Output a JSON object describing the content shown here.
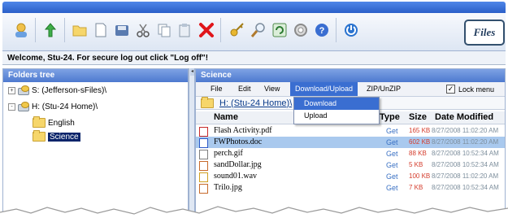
{
  "welcome_message": "Welcome, Stu-24. For secure log out click \"Log off\"!",
  "logo_text": "Files",
  "toolbar_icons": [
    "user-icon",
    "upload-icon",
    "folder-icon",
    "new-file-icon",
    "disk-icon",
    "cut-icon",
    "copy-icon",
    "paste-icon",
    "delete-icon",
    "key-icon",
    "search-icon",
    "refresh-icon",
    "settings-icon",
    "help-icon",
    "power-icon"
  ],
  "folders_panel": {
    "title": "Folders tree",
    "items": [
      {
        "label": "S: (Jefferson-sFiles)\\",
        "expander": "+"
      },
      {
        "label": "H: (Stu-24 Home)\\",
        "expander": "-"
      },
      {
        "label": "English"
      },
      {
        "label": "Science"
      }
    ]
  },
  "files_panel": {
    "title": "Science",
    "menu": [
      "File",
      "Edit",
      "View",
      "Download/Upload",
      "ZIP/UnZIP"
    ],
    "lock_menu": {
      "label": "Lock menu",
      "checked": true,
      "check_mark": "✓"
    },
    "path": "H: (Stu-24 Home)\\",
    "dropdown": [
      "Download",
      "Upload"
    ],
    "columns": [
      "Name",
      "Type",
      "Size",
      "Date Modified"
    ],
    "sort_indicator": "▲",
    "files": [
      {
        "name": "Flash Activity.pdf",
        "type": "Get",
        "size": "165 KB",
        "date": "8/27/2008 11:02:20 AM"
      },
      {
        "name": "FWPhotos.doc",
        "type": "Get",
        "size": "602 KB",
        "date": "8/27/2008 11:02:20 AM"
      },
      {
        "name": "perch.gif",
        "type": "Get",
        "size": "88 KB",
        "date": "8/27/2008 10:52:34 AM"
      },
      {
        "name": "sandDollar.jpg",
        "type": "Get",
        "size": "5 KB",
        "date": "8/27/2008 10:52:34 AM"
      },
      {
        "name": "sound01.wav",
        "type": "Get",
        "size": "100 KB",
        "date": "8/27/2008 11:02:20 AM"
      },
      {
        "name": "Trilo.jpg",
        "type": "Get",
        "size": "7 KB",
        "date": "8/27/2008 10:52:34 AM"
      }
    ]
  },
  "splitter": {
    "left_arrow": "◂"
  }
}
